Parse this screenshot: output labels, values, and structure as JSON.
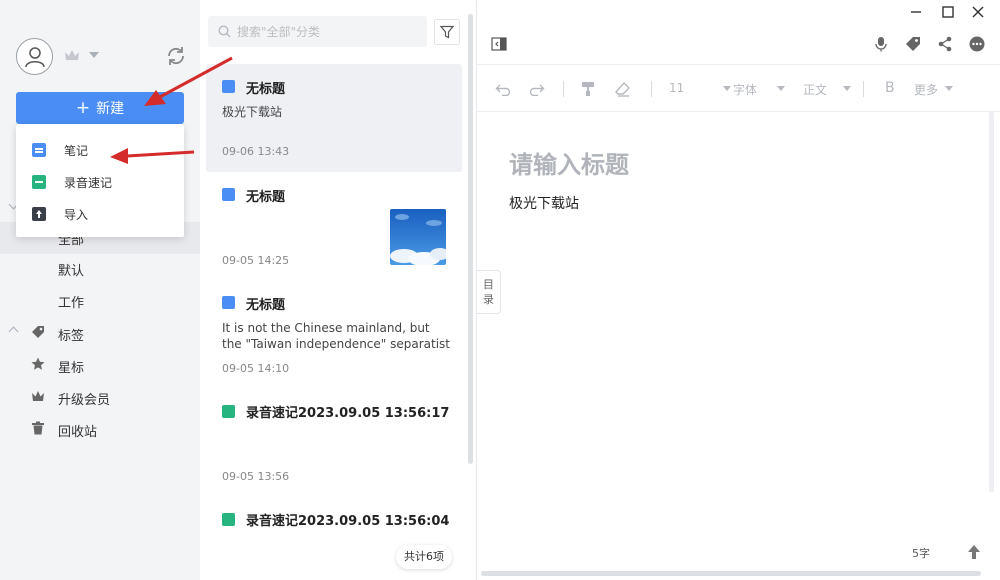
{
  "sidebar": {
    "new_button": "新建",
    "new_menu": [
      {
        "label": "笔记",
        "icon": "note-icon"
      },
      {
        "label": "录音速记",
        "icon": "record-icon"
      },
      {
        "label": "导入",
        "icon": "import-icon"
      }
    ],
    "categories": [
      "全部",
      "默认",
      "工作"
    ],
    "nav": [
      {
        "label": "标签",
        "icon": "tag-icon"
      },
      {
        "label": "星标",
        "icon": "star-icon"
      },
      {
        "label": "升级会员",
        "icon": "crown-icon"
      },
      {
        "label": "回收站",
        "icon": "trash-icon"
      }
    ]
  },
  "notelist": {
    "search_placeholder": "搜索\"全部\"分类",
    "notes": [
      {
        "title": "无标题",
        "snippet": "极光下载站",
        "date": "09-06 13:43",
        "type": "note",
        "selected": true
      },
      {
        "title": "无标题",
        "snippet": "",
        "date": "09-05 14:25",
        "type": "note",
        "has_image": true
      },
      {
        "title": "无标题",
        "snippet": "It is not the Chinese mainland, but the \"Taiwan independence\" separatist ...",
        "date": "09-05 14:10",
        "type": "note"
      },
      {
        "title": "录音速记2023.09.05 13:56:17",
        "snippet": "",
        "date": "09-05 13:56",
        "type": "record"
      },
      {
        "title": "录音速记2023.09.05 13:56:04",
        "snippet": "",
        "date": "",
        "type": "record"
      }
    ],
    "count_label": "共计6项"
  },
  "editor": {
    "toolbar": {
      "font_size": "11",
      "font": "字体",
      "paragraph": "正文",
      "bold": "B",
      "more": "更多"
    },
    "title_placeholder": "请输入标题",
    "body": "极光下载站",
    "toc_tab": [
      "目",
      "录"
    ],
    "word_count": "5字"
  },
  "colors": {
    "accent": "#4a8df5",
    "record_green": "#28b47e",
    "sidebar_bg": "#f3f4f6",
    "annotation_red": "#d42b2b"
  }
}
